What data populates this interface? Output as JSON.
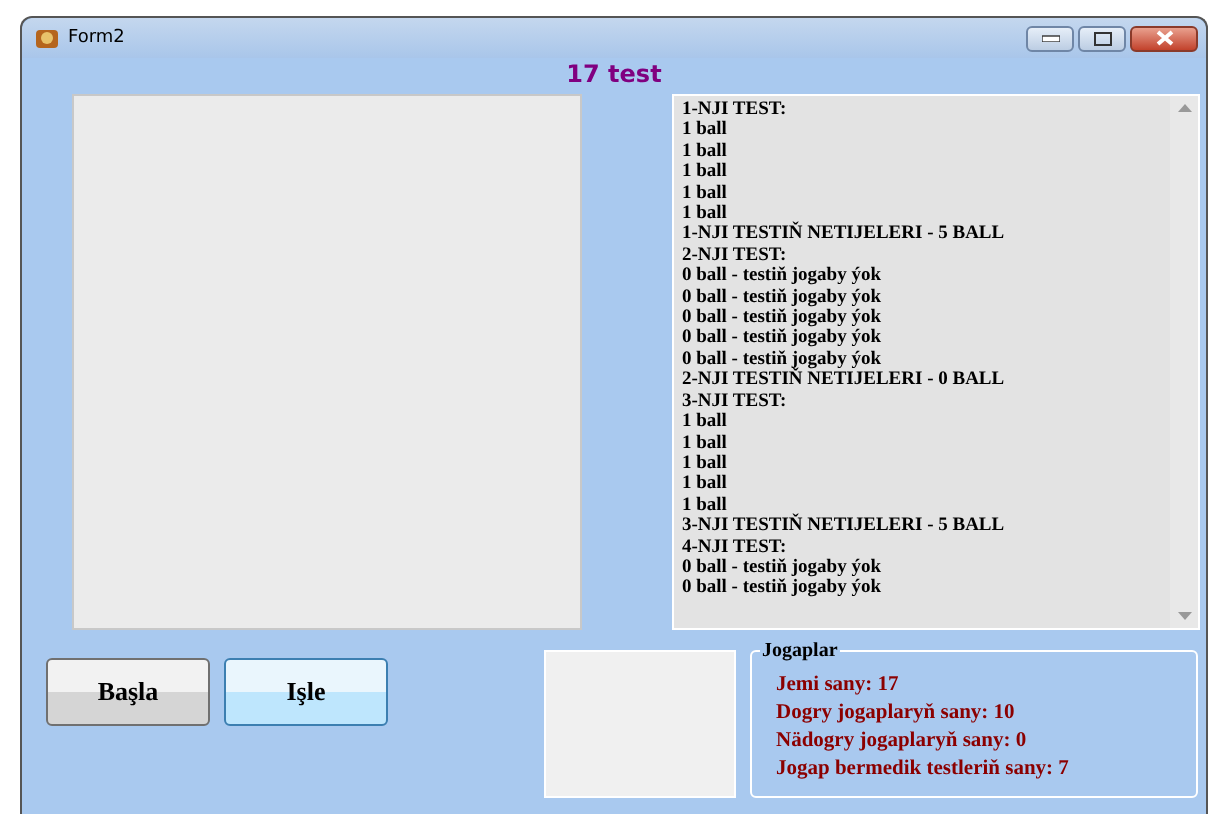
{
  "window": {
    "title": "Form2"
  },
  "heading": "17 test",
  "results_list": {
    "lines": [
      "1-NJI TEST:",
      "1 ball",
      "1 ball",
      "1 ball",
      "1 ball",
      "1 ball",
      "1-NJI TESTIŇ NETIJELERI - 5 BALL",
      "2-NJI TEST:",
      "0 ball - testiň jogaby ýok",
      "0 ball - testiň jogaby ýok",
      "0 ball - testiň jogaby ýok",
      "0 ball - testiň jogaby ýok",
      "0 ball - testiň jogaby ýok",
      "2-NJI TESTIŇ NETIJELERI - 0 BALL",
      "3-NJI TEST:",
      "1 ball",
      "1 ball",
      "1 ball",
      "1 ball",
      "1 ball",
      "3-NJI TESTIŇ NETIJELERI - 5 BALL",
      "4-NJI TEST:",
      "0 ball - testiň jogaby ýok",
      "0 ball - testiň jogaby ýok"
    ]
  },
  "buttons": [
    {
      "label": "Başla",
      "hovered": false
    },
    {
      "label": "Işle",
      "hovered": true
    }
  ],
  "summary": {
    "title": "Jogaplar",
    "lines": [
      "Jemi sany: 17",
      "Dogry jogaplaryň sany: 10",
      "Nädogry jogaplaryň sany: 0",
      "Jogap bermedik testleriň sany: 7"
    ]
  }
}
